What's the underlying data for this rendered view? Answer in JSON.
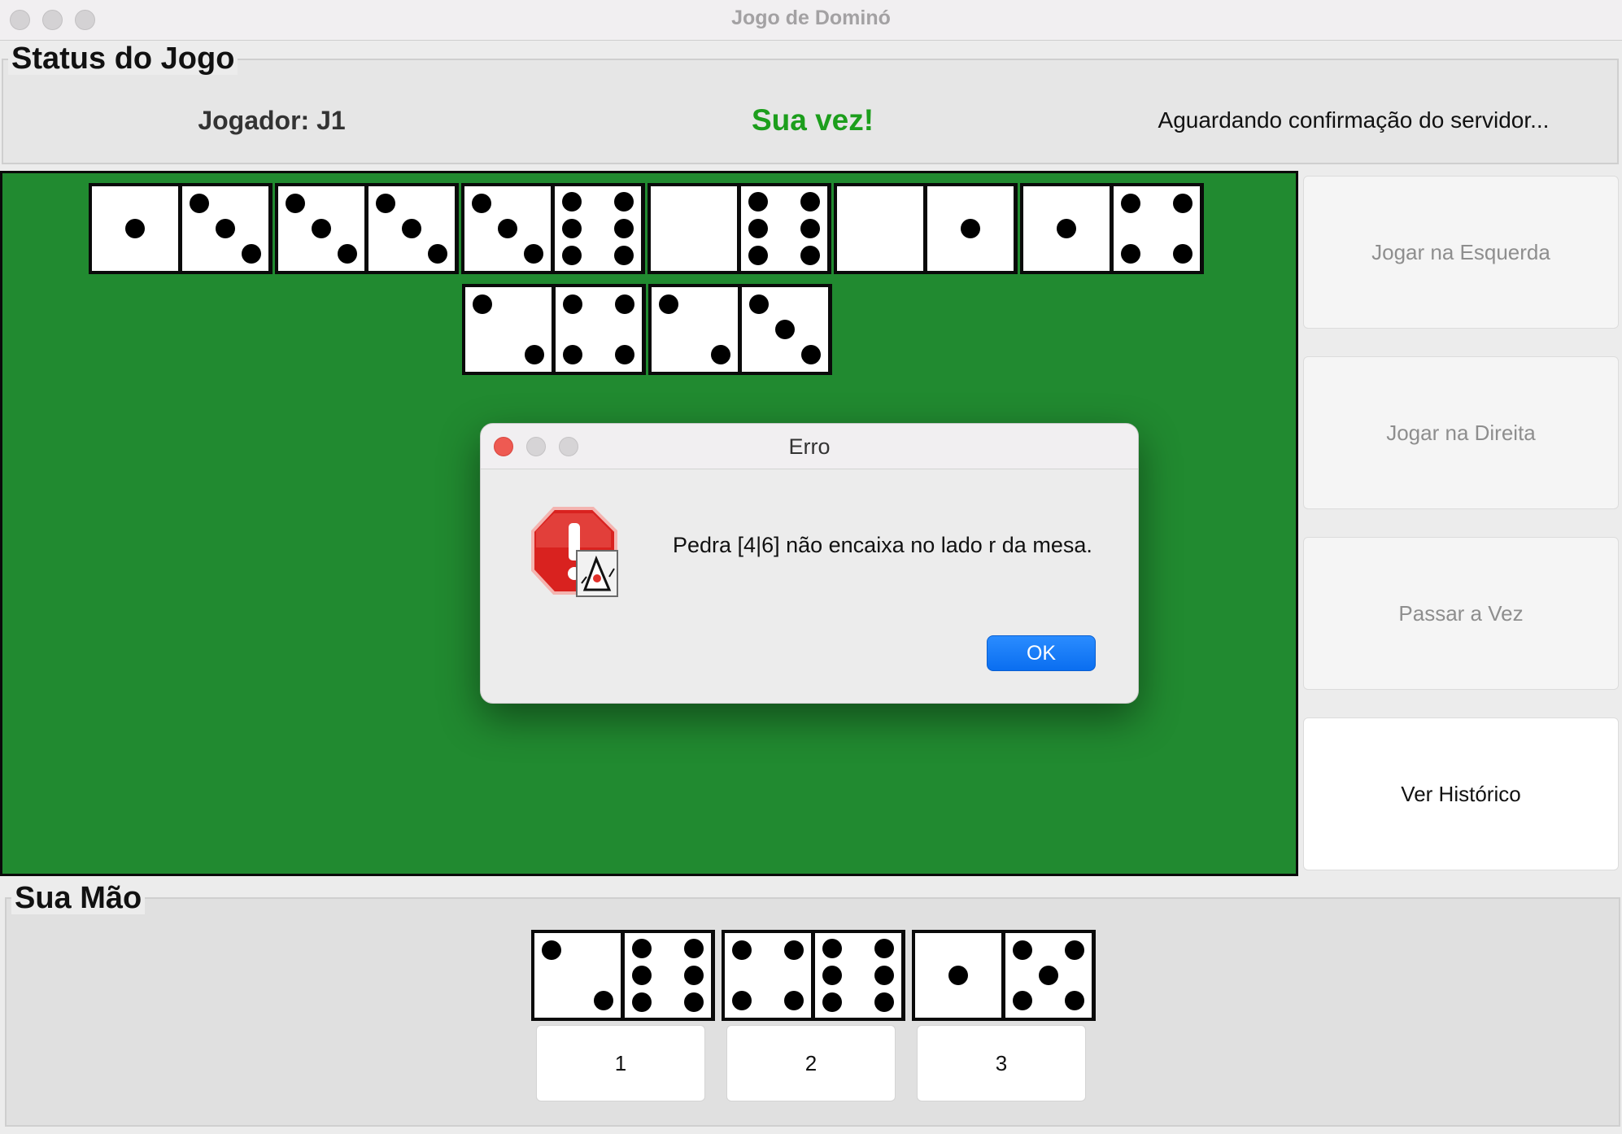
{
  "window": {
    "title": "Jogo de Dominó"
  },
  "status": {
    "legend": "Status do Jogo",
    "player": "Jogador: J1",
    "turn": "Sua vez!",
    "message": "Aguardando confirmação do servidor..."
  },
  "board": {
    "tiles": [
      [
        1,
        3
      ],
      [
        3,
        3
      ],
      [
        3,
        6
      ],
      [
        0,
        6
      ],
      [
        0,
        1
      ],
      [
        1,
        4
      ],
      [
        2,
        4
      ],
      [
        2,
        3
      ]
    ]
  },
  "actions": {
    "play_left": "Jogar na Esquerda",
    "play_right": "Jogar na Direita",
    "pass": "Passar a Vez",
    "history": "Ver Histórico"
  },
  "hand": {
    "legend": "Sua Mão",
    "tiles": [
      [
        2,
        6
      ],
      [
        4,
        6
      ],
      [
        1,
        5
      ]
    ],
    "buttons": [
      "1",
      "2",
      "3"
    ]
  },
  "dialog": {
    "title": "Erro",
    "message": "Pedra [4|6] não encaixa no lado r da mesa.",
    "ok_label": "OK",
    "icon": "error-stop-icon"
  },
  "colors": {
    "board": "#218a30",
    "turn_text": "#1c9e1c",
    "ok_button": "#0a6ef0"
  }
}
